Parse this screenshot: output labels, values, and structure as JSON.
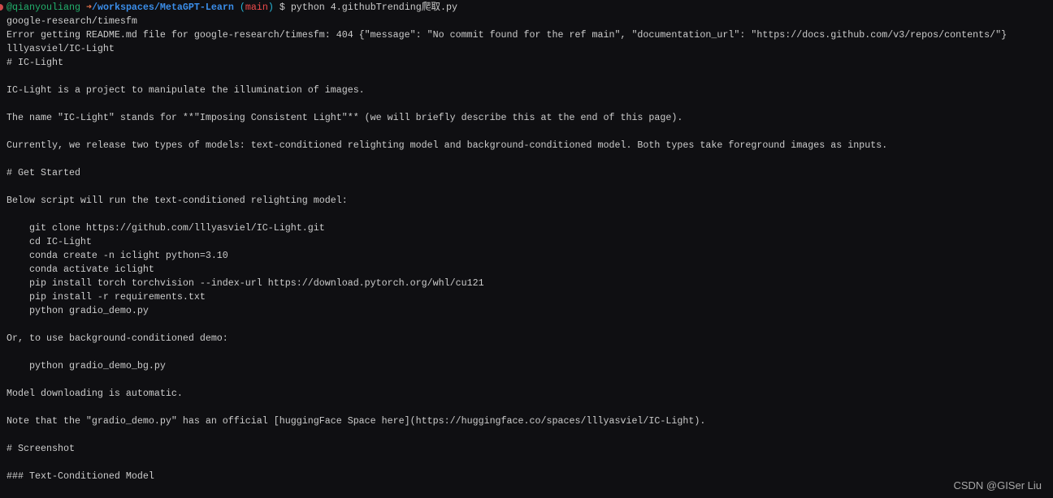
{
  "prompt": {
    "user": "@qianyouliang",
    "arrow": "➜",
    "path": "/workspaces/MetaGPT-Learn",
    "paren_open": " (",
    "branch": "main",
    "paren_close": ")",
    "command": " $ python 4.githubTrending爬取.py"
  },
  "output_lines": [
    "google-research/timesfm",
    "Error getting README.md file for google-research/timesfm: 404 {\"message\": \"No commit found for the ref main\", \"documentation_url\": \"https://docs.github.com/v3/repos/contents/\"}",
    "lllyasviel/IC-Light",
    "# IC-Light",
    "",
    "IC-Light is a project to manipulate the illumination of images.",
    "",
    "The name \"IC-Light\" stands for **\"Imposing Consistent Light\"** (we will briefly describe this at the end of this page).",
    "",
    "Currently, we release two types of models: text-conditioned relighting model and background-conditioned model. Both types take foreground images as inputs.",
    "",
    "# Get Started",
    "",
    "Below script will run the text-conditioned relighting model:",
    "",
    "    git clone https://github.com/lllyasviel/IC-Light.git",
    "    cd IC-Light",
    "    conda create -n iclight python=3.10",
    "    conda activate iclight",
    "    pip install torch torchvision --index-url https://download.pytorch.org/whl/cu121",
    "    pip install -r requirements.txt",
    "    python gradio_demo.py",
    "",
    "Or, to use background-conditioned demo:",
    "",
    "    python gradio_demo_bg.py",
    "",
    "Model downloading is automatic.",
    "",
    "Note that the \"gradio_demo.py\" has an official [huggingFace Space here](https://huggingface.co/spaces/lllyasviel/IC-Light).",
    "",
    "# Screenshot",
    "",
    "### Text-Conditioned Model"
  ],
  "watermark": "CSDN @GISer Liu",
  "colors": {
    "background": "#0f0f12",
    "text": "#cccccc",
    "user": "#23b26d",
    "path": "#3b8eea",
    "branch": "#f14c4c"
  }
}
